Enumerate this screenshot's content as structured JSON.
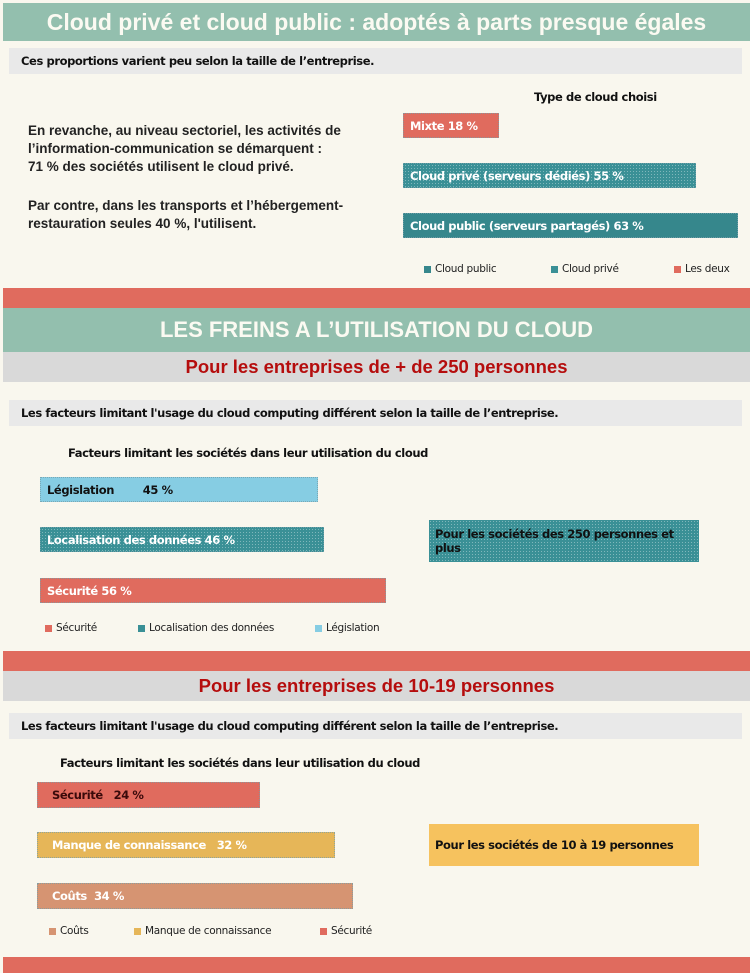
{
  "section1": {
    "title": "Cloud privé et cloud public : adoptés à parts presque égales",
    "note": "Ces proportions varient peu selon la taille de l’entreprise.",
    "paragraph1": [
      "En revanche, au niveau sectoriel, les activités de",
      "l’information-communication se démarquent :",
      "71 % des sociétés utilisent le cloud privé."
    ],
    "paragraph2": [
      "Par contre, dans les transports et l’hébergement-",
      "restauration seules 40 %, l'utilisent."
    ]
  },
  "section2": {
    "title": "LES FREINS A L’UTILISATION DU CLOUD",
    "subtitle_large": "Pour les entreprises de + de 250 personnes",
    "note_large": "Les facteurs limitant l'usage du cloud computing différent selon la taille de l’entreprise.",
    "callout_large": "Pour les sociétés des 250 personnes et plus",
    "subtitle_small": "Pour les entreprises de 10-19 personnes",
    "note_small": "Les facteurs limitant l'usage du cloud computing différent selon la taille de l’entreprise.",
    "callout_small": "Pour les sociétés de 10 à 19 personnes"
  },
  "colors": {
    "green_banner": "#93bfae",
    "red_banner": "#e06b5e",
    "teal": "#3a9096",
    "light_blue": "#86cde3",
    "orange": "#f6c25e",
    "tan": "#d69472",
    "title_red": "#b50d0d"
  },
  "chart_data": [
    {
      "type": "bar",
      "orientation": "horizontal",
      "title": "Type de cloud choisi",
      "unit": "%",
      "categories": [
        "Mixte",
        "Cloud privé (serveurs dédiés)",
        "Cloud public (serveurs partagés)"
      ],
      "values": [
        18,
        55,
        63
      ],
      "labels": [
        "Mixte  18 %",
        "Cloud privé (serveurs dédiés)  55 %",
        "Cloud public (serveurs partagés)  63 %"
      ],
      "legend": [
        "Cloud public",
        "Cloud privé",
        "Les deux"
      ],
      "legend_position": "bottom",
      "grid": false
    },
    {
      "type": "bar",
      "orientation": "horizontal",
      "title": "Facteurs limitant les sociétés dans leur utilisation du cloud",
      "subtitle": "Pour les sociétés des 250 personnes et plus",
      "unit": "%",
      "categories": [
        "Législation",
        "Localisation des données",
        "Sécurité"
      ],
      "values": [
        45,
        46,
        56
      ],
      "labels": [
        "Législation        45 %",
        "Localisation des données  46 %",
        "Sécurité  56 %"
      ],
      "legend": [
        "Sécurité",
        "Localisation des données",
        "Législation"
      ],
      "legend_position": "bottom",
      "grid": false
    },
    {
      "type": "bar",
      "orientation": "horizontal",
      "title": "Facteurs limitant les sociétés dans leur utilisation du cloud",
      "subtitle": "Pour les sociétés de 10 à 19 personnes",
      "unit": "%",
      "categories": [
        "Sécurité",
        "Manque de connaissance",
        "Coûts"
      ],
      "values": [
        24,
        32,
        34
      ],
      "labels": [
        "Sécurité   24 %",
        "Manque de connaissance   32 %",
        "Coûts  34 %"
      ],
      "legend": [
        "Coûts",
        "Manque de connaissance",
        "Sécurité"
      ],
      "legend_position": "bottom",
      "grid": false
    }
  ]
}
